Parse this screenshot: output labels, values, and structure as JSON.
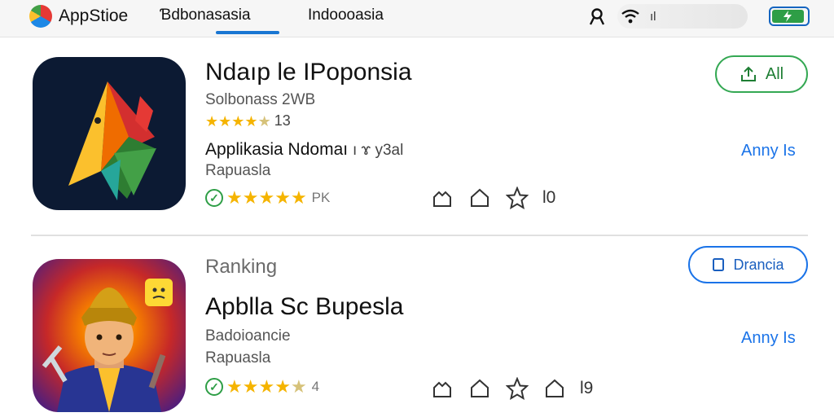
{
  "header": {
    "brand": "AppStioe",
    "tabs": [
      {
        "label": "Ɓdbonasasia",
        "active": true
      },
      {
        "label": "Indoooasia",
        "active": false
      }
    ],
    "status": {
      "icons": [
        "account-icon",
        "wifi-icon",
        "signal-icon",
        "battery-icon"
      ],
      "signal_text": "ıl",
      "battery_level": 0.92
    }
  },
  "apps": [
    {
      "title": "Ndaıp le IPoponsia",
      "subtitle": "Solbonass 2WB",
      "rating_count": "13",
      "rating": 4.5,
      "developer": "Applikasia Ndomaı",
      "developer_tag": "ı ɤ y3al",
      "region": "Rapuasla",
      "verified_stars": 5,
      "verified_label": "PK",
      "actions": [
        "share-icon",
        "home-icon",
        "star-outline-icon"
      ],
      "actions_label": "l0",
      "button_label": "All",
      "button_icon": "upload-icon",
      "side_link": "Anny Is"
    },
    {
      "kicker": "Ranking",
      "title": "Apblla Sc Bupesla",
      "subtitle": "Badoioancie",
      "region": "Rapuasla",
      "verified_stars": 4.5,
      "verified_label": "4",
      "actions": [
        "share-icon",
        "home-icon",
        "star-outline-icon",
        "home-icon"
      ],
      "actions_label": "l9",
      "button_label": "Drancia",
      "button_icon": "bookmark-icon",
      "side_link": "Anny Is"
    }
  ],
  "colors": {
    "accent_blue": "#1a73e8",
    "accent_green": "#34a853",
    "star": "#f5b400",
    "icon1_bg": "#0c1a33"
  }
}
